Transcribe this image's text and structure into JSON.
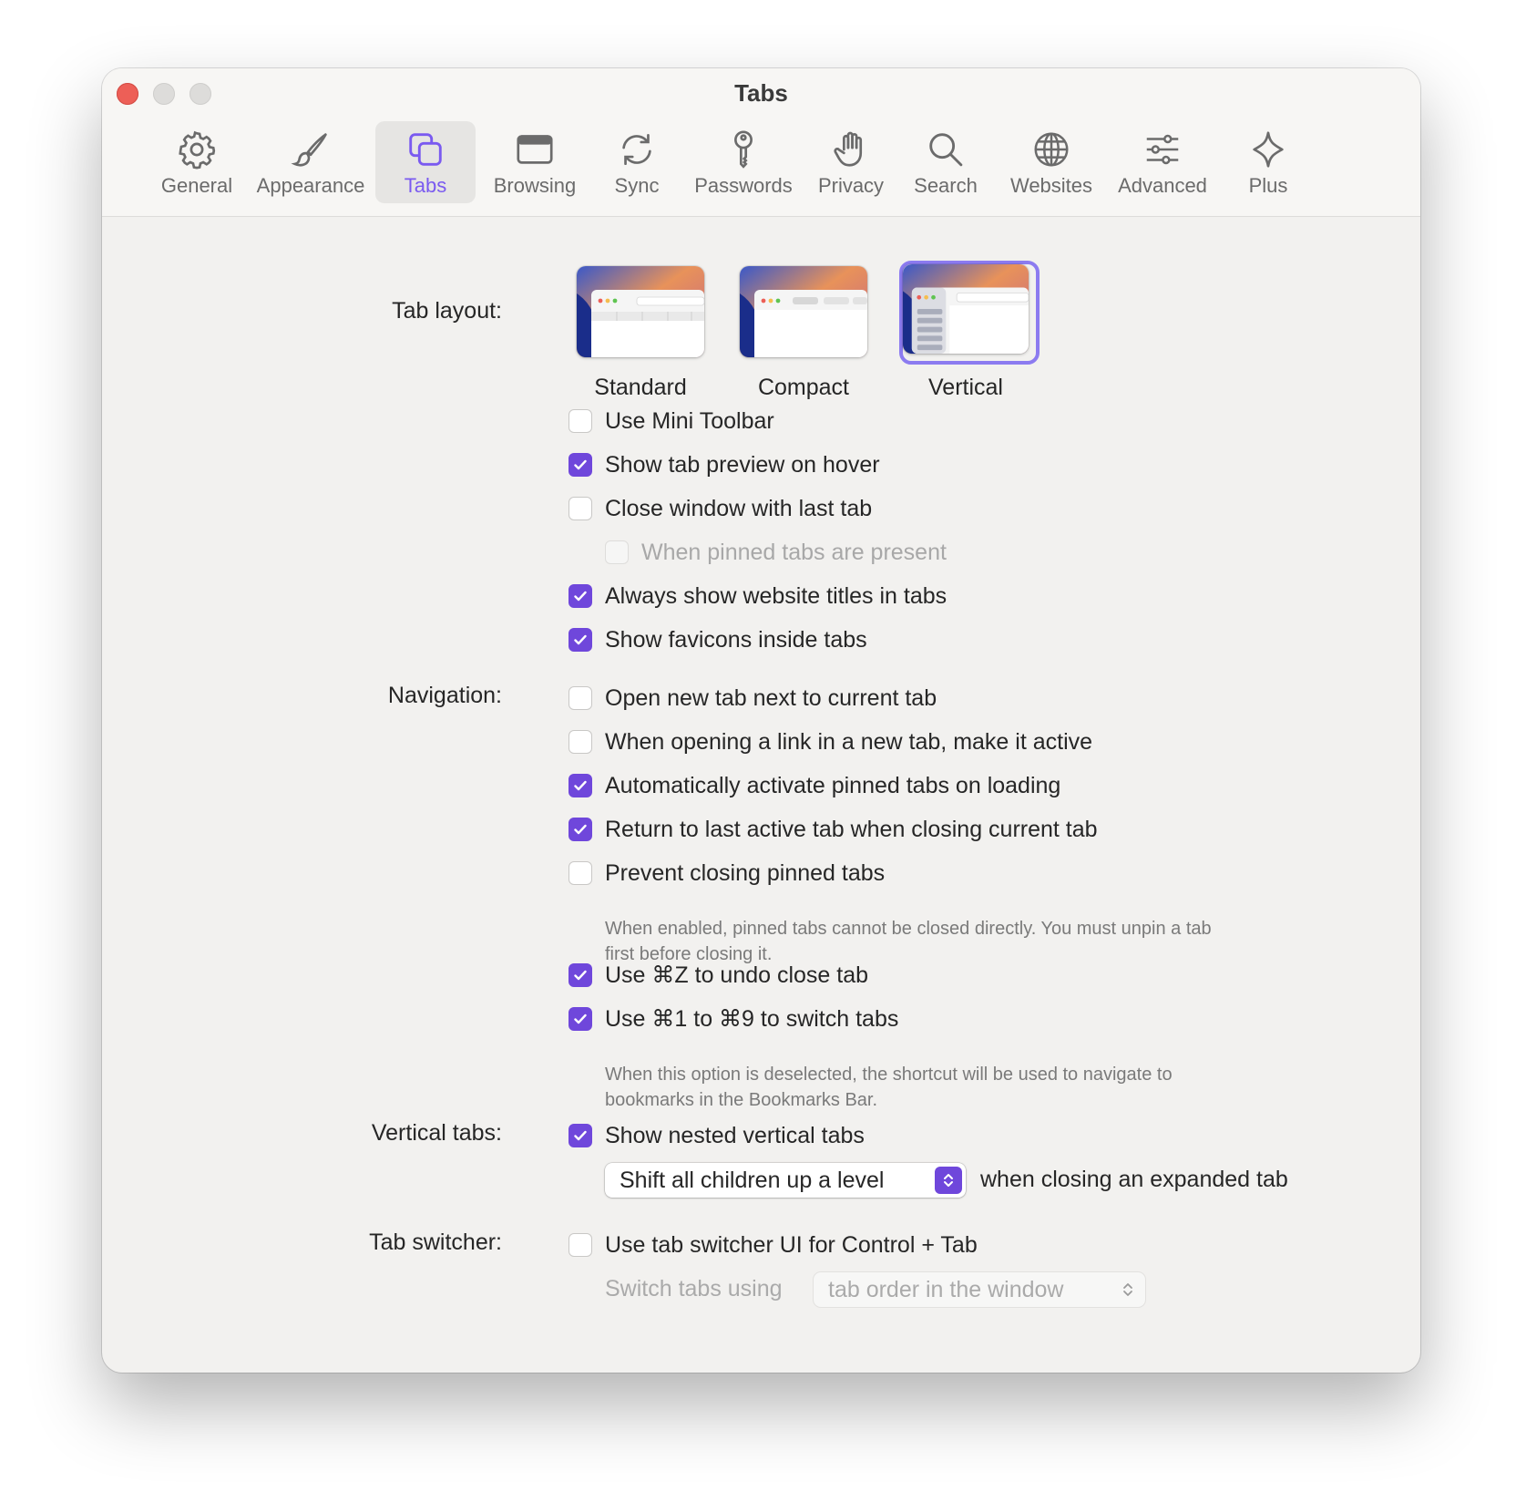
{
  "window": {
    "title": "Tabs"
  },
  "toolbar": [
    {
      "label": "General",
      "icon": "gear-icon"
    },
    {
      "label": "Appearance",
      "icon": "brush-icon"
    },
    {
      "label": "Tabs",
      "icon": "tabs-icon",
      "active": true
    },
    {
      "label": "Browsing",
      "icon": "browser-window-icon"
    },
    {
      "label": "Sync",
      "icon": "sync-icon"
    },
    {
      "label": "Passwords",
      "icon": "key-icon"
    },
    {
      "label": "Privacy",
      "icon": "hand-icon"
    },
    {
      "label": "Search",
      "icon": "magnifier-icon"
    },
    {
      "label": "Websites",
      "icon": "globe-icon"
    },
    {
      "label": "Advanced",
      "icon": "sliders-icon"
    },
    {
      "label": "Plus",
      "icon": "sparkle-icon"
    }
  ],
  "tab_layout": {
    "label": "Tab layout:",
    "options": [
      {
        "caption": "Standard",
        "selected": false
      },
      {
        "caption": "Compact",
        "selected": false
      },
      {
        "caption": "Vertical",
        "selected": true
      }
    ]
  },
  "general_options": [
    {
      "text": "Use Mini Toolbar",
      "checked": false
    },
    {
      "text": "Show tab preview on hover",
      "checked": true
    },
    {
      "text": "Close window with last tab",
      "checked": false
    },
    {
      "text": "When pinned tabs are present",
      "checked": false,
      "disabled": true
    },
    {
      "text": "Always show website titles in tabs",
      "checked": true
    },
    {
      "text": "Show favicons inside tabs",
      "checked": true
    }
  ],
  "navigation": {
    "label": "Navigation:",
    "options": [
      {
        "text": "Open new tab next to current tab",
        "checked": false
      },
      {
        "text": "When opening a link in a new tab, make it active",
        "checked": false
      },
      {
        "text": "Automatically activate pinned tabs on loading",
        "checked": true
      },
      {
        "text": "Return to last active tab when closing current tab",
        "checked": true
      },
      {
        "text": "Prevent closing pinned tabs",
        "checked": false
      },
      {
        "text": "Use ⌘Z to undo close tab",
        "checked": true
      },
      {
        "text": "Use ⌘1 to ⌘9 to switch tabs",
        "checked": true
      }
    ],
    "help_pinned": "When enabled, pinned tabs cannot be closed directly. You must unpin a tab first before closing it.",
    "help_shortcut": "When this option is deselected, the shortcut will be used to navigate to bookmarks in the Bookmarks Bar."
  },
  "vertical_tabs": {
    "label": "Vertical tabs:",
    "option": {
      "text": "Show nested vertical tabs",
      "checked": true
    },
    "popup_value": "Shift all children up a level",
    "popup_suffix": "when closing an expanded tab"
  },
  "tab_switcher": {
    "label": "Tab switcher:",
    "option": {
      "text": "Use tab switcher UI for Control + Tab",
      "checked": false
    },
    "switch_label": "Switch tabs using",
    "switch_value": "tab order in the window"
  },
  "colors": {
    "accent": "#6f47db",
    "accent_text": "#7a5af0",
    "close": "#ed5f57"
  }
}
